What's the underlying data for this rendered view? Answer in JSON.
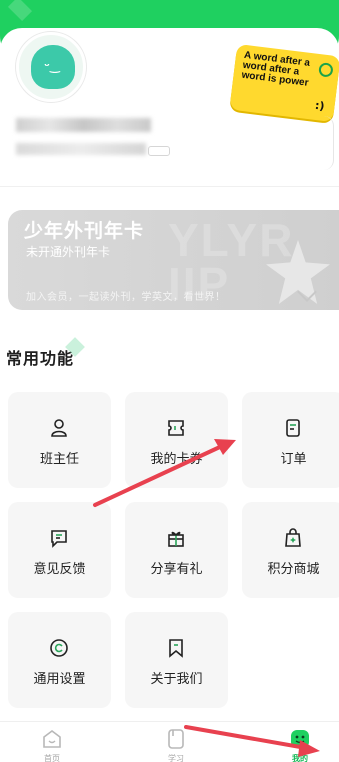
{
  "sticker": {
    "text": "A word after a word after a word is power"
  },
  "vip": {
    "title": "少年外刊年卡",
    "subtitle": "未开通外刊年卡",
    "description": "加入会员，一起读外刊，学英文，看世界！",
    "bg_text": "YLYR\nIIP"
  },
  "section": {
    "title": "常用功能"
  },
  "features": [
    {
      "label": "班主任",
      "icon": "person-icon"
    },
    {
      "label": "我的卡券",
      "icon": "coupon-icon"
    },
    {
      "label": "订单",
      "icon": "order-icon"
    },
    {
      "label": "意见反馈",
      "icon": "feedback-icon"
    },
    {
      "label": "分享有礼",
      "icon": "gift-icon"
    },
    {
      "label": "积分商城",
      "icon": "shopping-bag-icon"
    },
    {
      "label": "通用设置",
      "icon": "settings-icon"
    },
    {
      "label": "关于我们",
      "icon": "bookmark-icon"
    }
  ],
  "nav": {
    "items": [
      {
        "label": "首页",
        "icon": "home-icon",
        "active": false
      },
      {
        "label": "学习",
        "icon": "study-icon",
        "active": false
      },
      {
        "label": "我的",
        "icon": "profile-icon",
        "active": true
      }
    ]
  },
  "colors": {
    "brand_green": "#1fd060",
    "accent_yellow": "#ffd92e",
    "arrow_red": "#e8414f"
  }
}
